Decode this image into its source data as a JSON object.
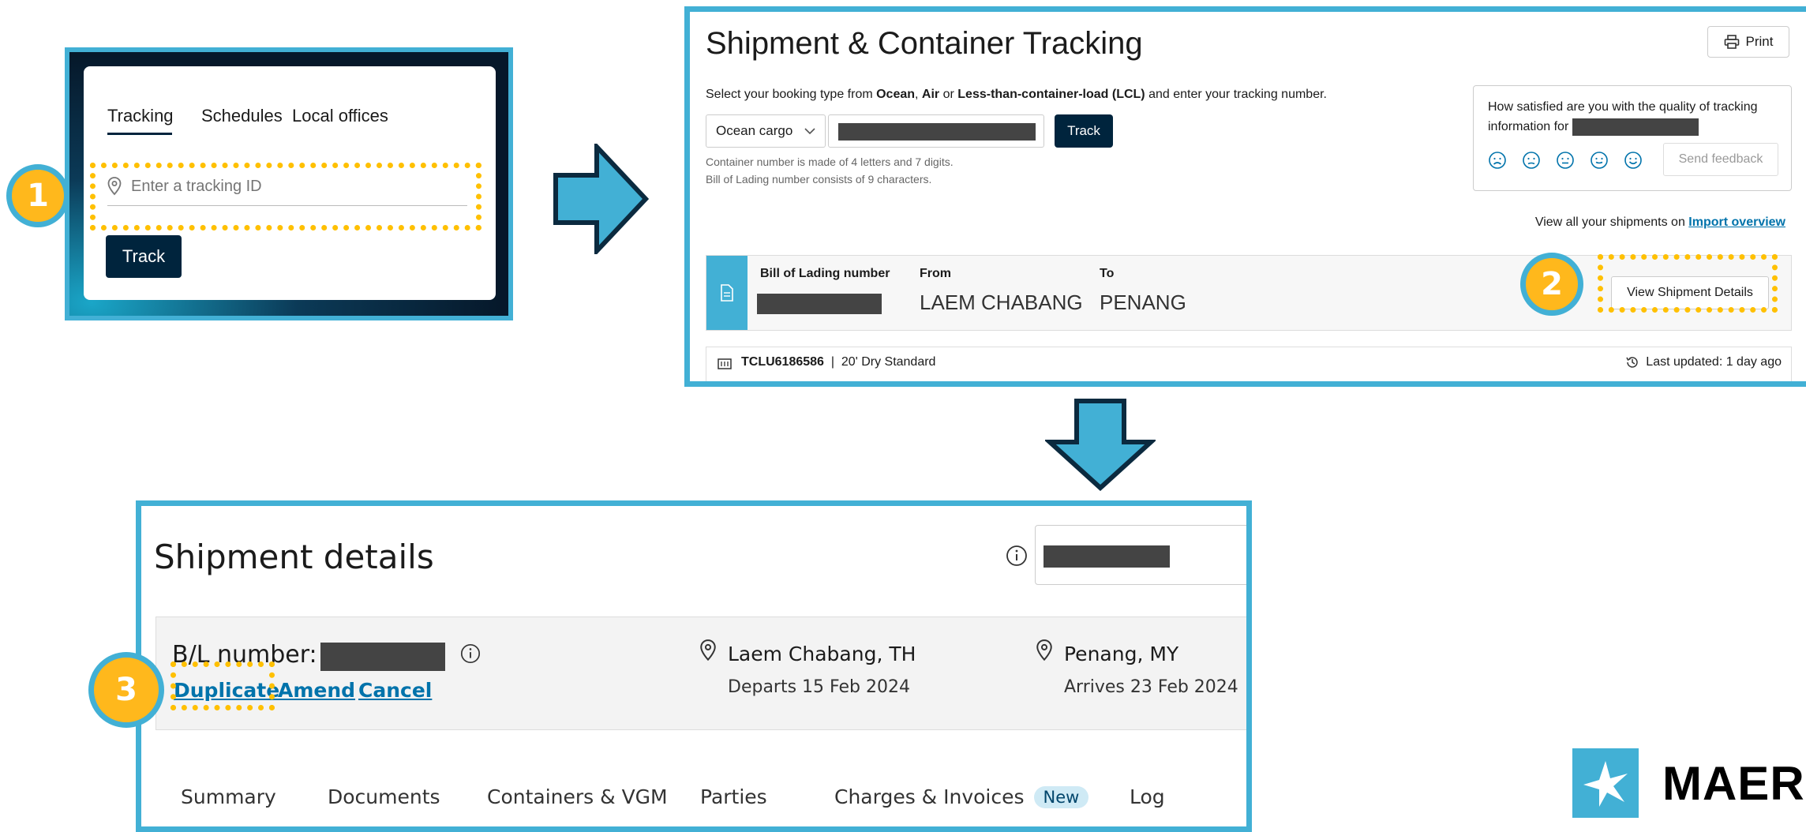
{
  "panel1": {
    "tabs": [
      "Tracking",
      "Schedules",
      "Local offices"
    ],
    "placeholder": "Enter a tracking ID",
    "track_label": "Track"
  },
  "badges": {
    "step1": "1",
    "step2": "2",
    "step3": "3"
  },
  "panel2": {
    "title": "Shipment & Container Tracking",
    "print_label": "Print",
    "intro_prefix": "Select your booking type from ",
    "intro_ocean": "Ocean",
    "intro_sep1": ", ",
    "intro_air": "Air",
    "intro_or": " or ",
    "intro_lcl": "Less-than-container-load (LCL)",
    "intro_suffix": " and enter your tracking number.",
    "booking_type": "Ocean cargo",
    "track_label": "Track",
    "hint_container": "Container number is made of 4 letters and 7 digits.",
    "hint_bl": "Bill of Lading number consists of 9 characters.",
    "feedback_question": "How satisfied are you with the quality of tracking information for",
    "send_feedback": "Send feedback",
    "view_all_prefix": "View all your shipments on ",
    "import_overview": "Import overview",
    "bl_label": "Bill of Lading number",
    "from_label": "From",
    "from_value": "LAEM CHABANG",
    "to_label": "To",
    "to_value": "PENANG",
    "view_details": "View Shipment Details",
    "container_id": "TCLU6186586",
    "container_sep": "|",
    "container_type": "20' Dry Standard",
    "last_updated": "Last updated: 1 day ago"
  },
  "panel3": {
    "title": "Shipment details",
    "bl_label": "B/L number:",
    "duplicate": "Duplicate",
    "amend": "Amend",
    "cancel": "Cancel",
    "origin": "Laem Chabang, TH",
    "departs": "Departs 15 Feb 2024",
    "destination": "Penang, MY",
    "arrives": "Arrives 23 Feb 2024",
    "tabs": [
      "Summary",
      "Documents",
      "Containers & VGM",
      "Parties",
      "Charges & Invoices",
      "Log"
    ],
    "new_badge": "New"
  },
  "logo": {
    "text": "MAER"
  },
  "colors": {
    "frame": "#42b0d5",
    "highlight": "#ffc000",
    "navy": "#00243d",
    "link": "#0073ab"
  }
}
